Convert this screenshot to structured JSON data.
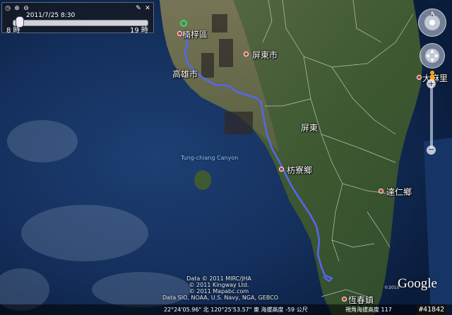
{
  "time_slider": {
    "current_label": "2011/7/25   8:30",
    "start_label": "8 時",
    "end_label": "19 時",
    "progress": 0.02
  },
  "map": {
    "ocean_label": "Tung-chiang Canyon",
    "places": [
      {
        "name": "楠梓區",
        "marker": "route-start"
      },
      {
        "name": "屏東市",
        "marker": "dot"
      },
      {
        "name": "高雄市",
        "marker": "none"
      },
      {
        "name": "屏東",
        "marker": "none"
      },
      {
        "name": "枋寮鄉",
        "marker": "dot"
      },
      {
        "name": "大麻里",
        "marker": "dot"
      },
      {
        "name": "達仁鄉",
        "marker": "dot"
      },
      {
        "name": "恆春鎮",
        "marker": "dot"
      }
    ],
    "route_color": "#5566ee"
  },
  "credits": {
    "line1": "Data © 2011 MIRC/JHA",
    "line2": "© 2011 Kingway Ltd.",
    "line3": "© 2011 Mapabc.com",
    "line4": "Data SIO, NOAA, U.S. Navy, NGA, GEBCO"
  },
  "branding": {
    "logo": "Google",
    "small_copyright": "©2010"
  },
  "status": {
    "coordinates": "22°24'05.96\" 北  120°25'53.57\" 東  海拔高度  -59 公尺",
    "eye_altitude": "視角海拔高度  117",
    "image_id": "#41842"
  },
  "icons": {
    "time_controls": [
      "wrench-icon",
      "close-icon",
      "zoom-in-icon",
      "zoom-out-icon",
      "clock-icon"
    ],
    "nav": [
      "look-around-icon",
      "move-icon",
      "pegman-icon",
      "zoom-slider-icon"
    ]
  }
}
